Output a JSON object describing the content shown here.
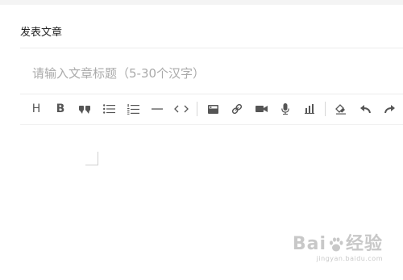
{
  "page": {
    "title": "发表文章"
  },
  "article": {
    "title_value": "",
    "title_placeholder": "请输入文章标题（5-30个汉字）"
  },
  "toolbar": {
    "heading_label": "H",
    "bold_label": "B",
    "groups": [
      [
        "heading-icon",
        "bold-icon",
        "quote-icon",
        "bullet-list-icon",
        "numbered-list-icon",
        "horizontal-rule-icon",
        "code-icon"
      ],
      [
        "image-icon",
        "link-icon",
        "video-icon",
        "audio-icon",
        "chart-icon"
      ],
      [
        "eraser-icon",
        "undo-icon",
        "redo-icon"
      ]
    ]
  },
  "editor": {
    "content": ""
  },
  "watermark": {
    "logo_a": "Bai",
    "logo_b": "经验",
    "sub": "jingyan.baidu.com"
  },
  "colors": {
    "icon": "#555555",
    "placeholder": "#aaaaaa",
    "divider": "#ececec",
    "watermark": "#c8c8c8"
  }
}
